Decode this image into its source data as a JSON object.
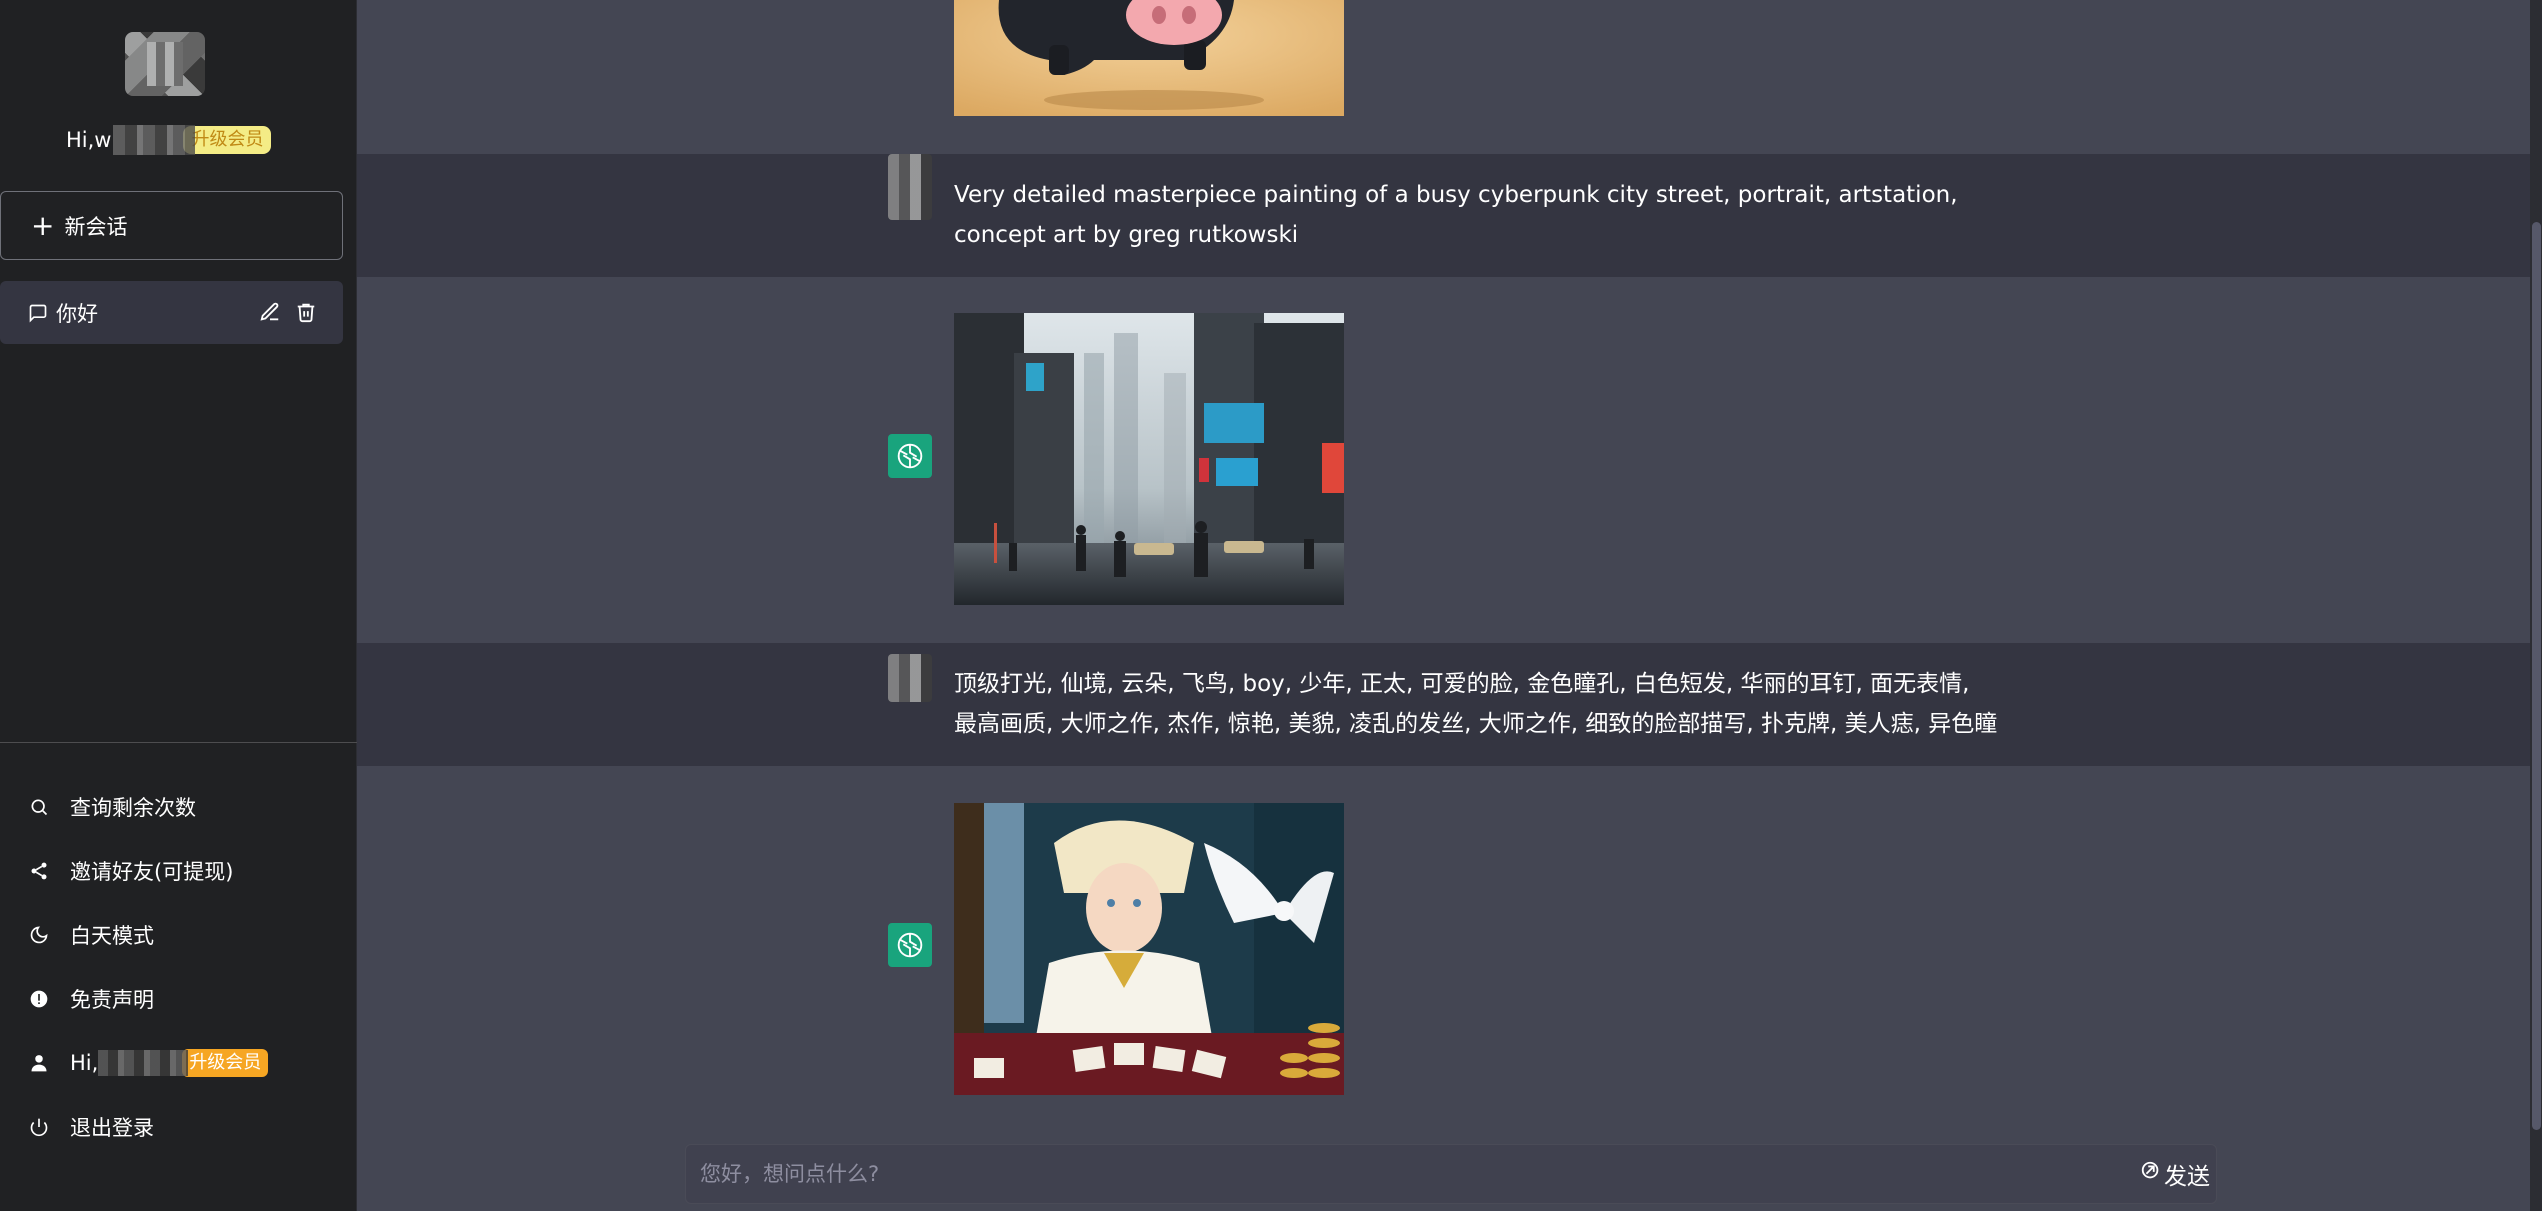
{
  "sidebar": {
    "greeting_prefix": "Hi,w",
    "upgrade_badge": "升级会员",
    "new_chat_label": "新会话",
    "chats": [
      {
        "label": "你好",
        "active": true
      }
    ],
    "menu": [
      {
        "label": "查询剩余次数",
        "icon": "search-icon"
      },
      {
        "label": "邀请好友(可提现)",
        "icon": "share-icon"
      },
      {
        "label": "白天模式",
        "icon": "moon-icon"
      },
      {
        "label": "免责声明",
        "icon": "alert-icon"
      },
      {
        "label": "Hi,",
        "icon": "user-icon",
        "badge": "升级会员"
      },
      {
        "label": "退出登录",
        "icon": "power-icon"
      }
    ]
  },
  "conversation": [
    {
      "role": "assistant",
      "type": "image",
      "subject": "pig"
    },
    {
      "role": "user",
      "text": "Very detailed masterpiece painting of a busy  cyberpunk city street, portrait, artstation, concept art  by greg rutkowski"
    },
    {
      "role": "assistant",
      "type": "image",
      "subject": "city"
    },
    {
      "role": "user",
      "text": "顶级打光, 仙境, 云朵, 飞鸟, boy, 少年, 正太, 可爱的脸, 金色瞳孔, 白色短发, 华丽的耳钉, 面无表情, 最高画质, 大师之作, 杰作, 惊艳, 美貌, 凌乱的发丝, 大师之作, 细致的脸部描写, 扑克牌, 美人痣, 异色瞳"
    },
    {
      "role": "assistant",
      "type": "image",
      "subject": "boy"
    }
  ],
  "input": {
    "placeholder": "您好，想问点什么?",
    "value": "",
    "send_label": "发送"
  },
  "colors": {
    "sidebar_bg": "#202123",
    "user_row_bg": "#343541",
    "bot_row_bg": "#444653",
    "bot_avatar": "#19a47d",
    "badge_yellow": "#f4ec86",
    "badge_orange": "#f6a623"
  }
}
